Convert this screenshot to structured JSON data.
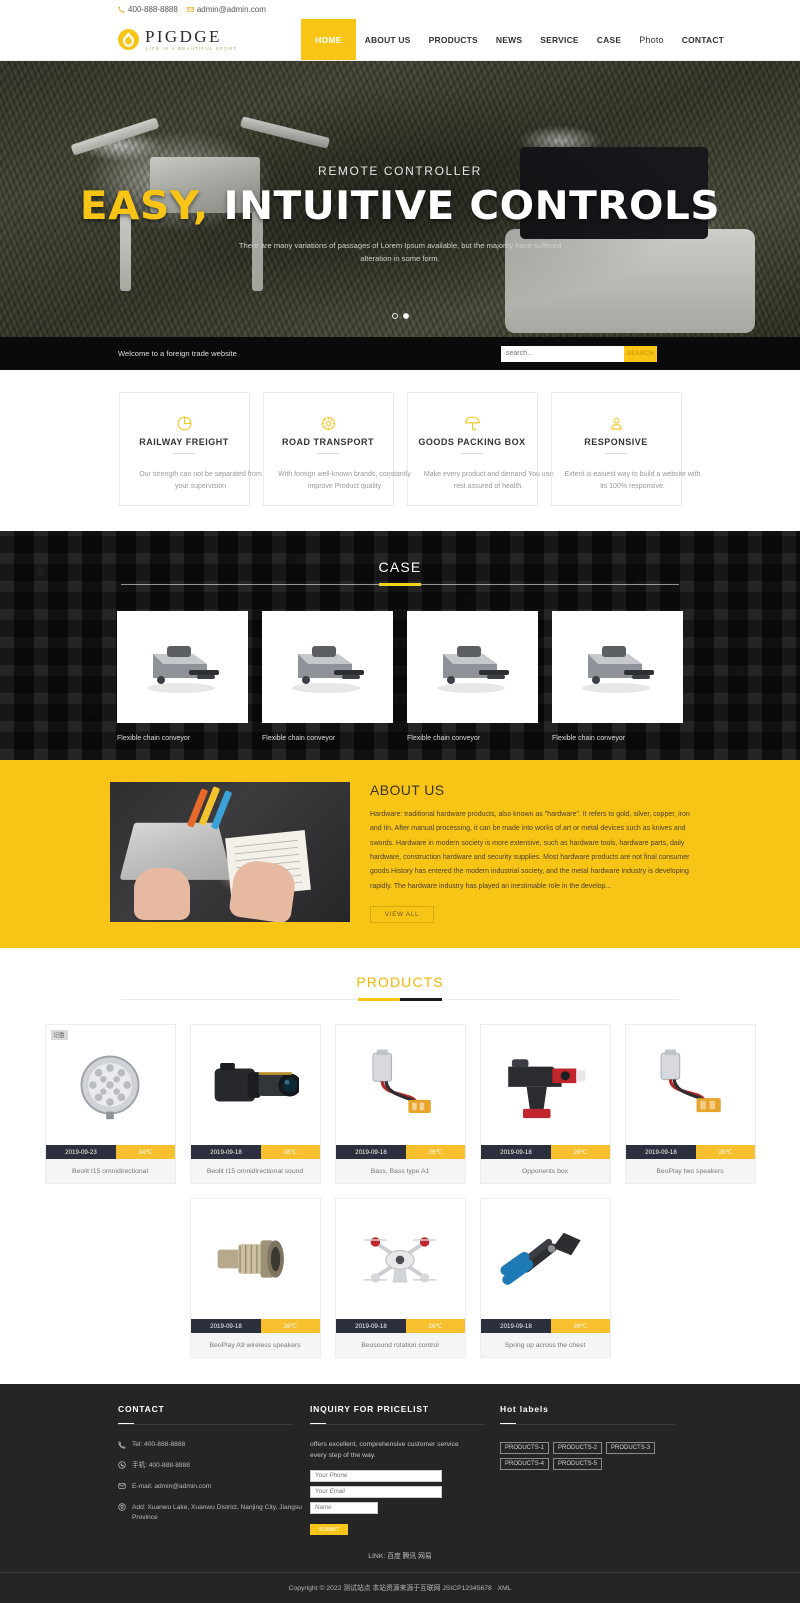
{
  "topbar": {
    "phone": "400-888-8888",
    "email": "admin@admin.com"
  },
  "brand": {
    "name": "PIGDGE",
    "tagline": "LIFE IS A BEAUTIFUL SPORT"
  },
  "nav": {
    "items": [
      {
        "label": "HOME",
        "active": true
      },
      {
        "label": "ABOUT US",
        "active": false
      },
      {
        "label": "PRODUCTS",
        "active": false
      },
      {
        "label": "NEWS",
        "active": false
      },
      {
        "label": "SERVICE",
        "active": false
      },
      {
        "label": "CASE",
        "active": false
      },
      {
        "label": "Photo",
        "active": false
      },
      {
        "label": "CONTACT",
        "active": false
      }
    ]
  },
  "hero": {
    "kicker": "REMOTE CONTROLLER",
    "title_accent": "EASY,",
    "title_rest": "INTUITIVE CONTROLS",
    "subtitle": "There are many variations of passages of Lorem Ipsum available, but the majority have suffered alteration in some form.",
    "slides": 2,
    "active_slide": 2
  },
  "strip": {
    "welcome": "Welcome to a foreign trade website",
    "search_placeholder": "search...",
    "search_value": "",
    "search_button": "SEARCH"
  },
  "features": [
    {
      "icon": "railway-freight-icon",
      "title": "RAILWAY FREIGHT",
      "desc": "Our strength can not be separated from your supervision"
    },
    {
      "icon": "road-transport-icon",
      "title": "ROAD TRANSPORT",
      "desc": "With foreign well-known brands, constantly improve Product quality"
    },
    {
      "icon": "goods-packing-box-icon",
      "title": "GOODS PACKING BOX",
      "desc": "Make every product and demand You use rest assured of health."
    },
    {
      "icon": "responsive-icon",
      "title": "RESPONSIVE",
      "desc": "Extent is easiest way to build a website with its 100% responsive."
    }
  ],
  "case": {
    "heading": "CASE",
    "items": [
      {
        "caption": "Flexible chain conveyor"
      },
      {
        "caption": "Flexible chain conveyor"
      },
      {
        "caption": "Flexible chain conveyor"
      },
      {
        "caption": "Flexible chain conveyor"
      }
    ]
  },
  "about": {
    "heading": "ABOUT US",
    "body": "Hardware: traditional hardware products, also known as \"hardware\". It refers to gold, silver, copper, iron and tin. After manual processing, it can be made into works of art or metal devices such as knives and swords. Hardware in modern society is more extensive, such as hardware tools, hardware parts, daily hardware, construction hardware and security supplies. Most hardware products are not final consumer goods.History has entered the modern industrial society, and the metal hardware industry is developing rapidly. The hardware industry has played an inestimable role in the develop...",
    "button": "VIEW ALL"
  },
  "products": {
    "heading": "PRODUCTS",
    "items": [
      {
        "tag": "记盘",
        "date": "2019-09-23",
        "temp": "34℃",
        "name": "Beolit I15 omnidirectional",
        "kind": "ring-light"
      },
      {
        "tag": "",
        "date": "2019-09-18",
        "temp": "28℃",
        "name": "Beolit I15 omnidirectional sound",
        "kind": "camera"
      },
      {
        "tag": "",
        "date": "2019-09-18",
        "temp": "26℃",
        "name": "Bass, Bass type A1",
        "kind": "connector"
      },
      {
        "tag": "",
        "date": "2019-09-18",
        "temp": "26℃",
        "name": "Opponents box",
        "kind": "power-tool"
      },
      {
        "tag": "",
        "date": "2019-09-18",
        "temp": "26℃",
        "name": "BeoPlay two speakers",
        "kind": "terminal-block"
      },
      {
        "tag": "",
        "date": "2019-09-18",
        "temp": "26℃",
        "name": "BeoPlay A9 wireless speakers",
        "kind": "metal-coupler"
      },
      {
        "tag": "",
        "date": "2019-09-18",
        "temp": "26℃",
        "name": "Beosound rotation control",
        "kind": "drone"
      },
      {
        "tag": "",
        "date": "2019-09-18",
        "temp": "26℃",
        "name": "Spring up across the chest",
        "kind": "crimper"
      }
    ]
  },
  "footer": {
    "contact": {
      "heading": "CONTACT",
      "rows": [
        {
          "icon": "phone-icon",
          "text": "Tel:  400-888-8888"
        },
        {
          "icon": "whatsapp-icon",
          "text": "手机:  400-888-8888"
        },
        {
          "icon": "mail-icon",
          "text": "E-mail: admin@admin.com"
        },
        {
          "icon": "location-icon",
          "text": "Add:  Xuanwu Lake, Xuanwu District, Nanjing City, Jiangsu Province"
        }
      ]
    },
    "inquiry": {
      "heading": "INQUIRY FOR PRICELIST",
      "desc": "offers excellent, comprehensive customer service every step of the way.",
      "phone_placeholder": "Your Phone",
      "email_placeholder": "Your Email",
      "name_placeholder": "Name",
      "submit": "SUBMIT"
    },
    "hot": {
      "heading": "Hot labels",
      "labels": [
        "PRODUCTS-1",
        "PRODUCTS-2",
        "PRODUCTS-3",
        "PRODUCTS-4",
        "PRODUCTS-5"
      ]
    },
    "links": {
      "prefix": "LINK:",
      "items": [
        "百度",
        "腾讯",
        "网易"
      ]
    },
    "copyright": "Copyright © 2022 测试站点 本站资源来源于互联网",
    "icp": "JSICP12345678",
    "xml": "XML"
  },
  "colors": {
    "accent": "#f8c517",
    "dark": "#252525",
    "strip": "#0a0a0a",
    "meta_date": "#2b2f3e",
    "meta_temp": "#f8bf2e"
  }
}
